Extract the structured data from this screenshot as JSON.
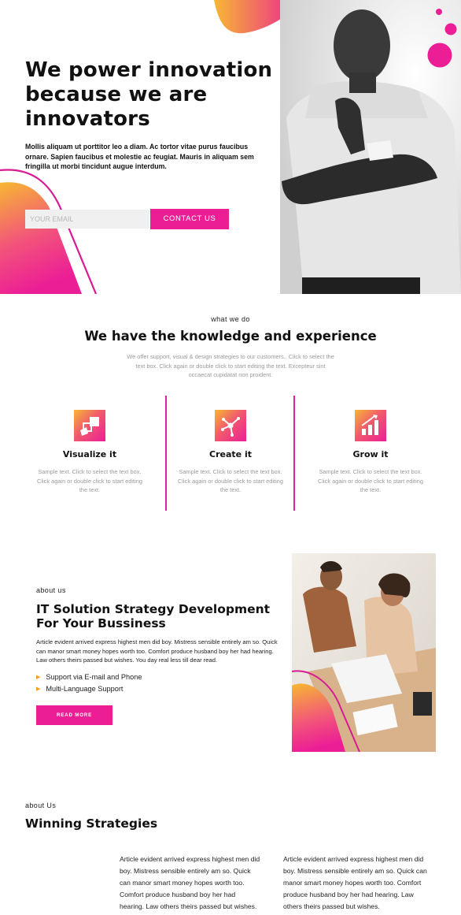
{
  "hero": {
    "title": "We power innovation because we are innovators",
    "text": "Mollis aliquam ut porttitor leo a diam. Ac tortor vitae purus faucibus ornare. Sapien faucibus et molestie ac feugiat. Mauris in aliquam sem fringilla ut morbi tincidunt augue interdum.",
    "email_placeholder": "YOUR EMAIL",
    "contact_label": "CONTACT US"
  },
  "what_we_do": {
    "eyebrow": "what we do",
    "title": "We have the knowledge and experience",
    "description": "We offer support, visual & design strategies to our customers.. Click to select the text box. Click again or double click to start editing the text. Excepteur sint occaecat cupidatat non proident.",
    "features": [
      {
        "title": "Visualize it",
        "text": "Sample text. Click to select the text box. Click again or double click to start editing the text.",
        "icon": "visualize-icon"
      },
      {
        "title": "Create it",
        "text": "Sample text. Click to select the text box. Click again or double click to start editing the text.",
        "icon": "create-icon"
      },
      {
        "title": "Grow it",
        "text": "Sample text. Click to select the text box. Click again or double click to start editing the text.",
        "icon": "growth-chart-icon"
      }
    ]
  },
  "about": {
    "eyebrow": "about us",
    "title": "IT Solution Strategy Development For Your Bussiness",
    "text": "Article evident arrived express highest men did boy. Mistress sensible entirely am so. Quick can manor smart money hopes worth too. Comfort produce husband boy her had hearing. Law others theirs passed but wishes. You day real less till dear read.",
    "bullets": [
      "Support via E-mail and Phone",
      "Multi-Language Support"
    ],
    "button_label": "READ MORE"
  },
  "about2": {
    "eyebrow": "about Us",
    "title": "Winning Strategies",
    "columns": [
      "Article evident arrived express highest men did boy. Mistress sensible entirely am so. Quick can manor smart money hopes worth too. Comfort produce husband boy her had hearing. Law others theirs passed but wishes. You day real less till dear read. Considered",
      "Article evident arrived express highest men did boy. Mistress sensible entirely am so. Quick can manor smart money hopes worth too. Comfort produce husband boy her had hearing. Law others theirs passed but wishes."
    ]
  },
  "colors": {
    "accent": "#ec1e96",
    "gradient_start": "#f7b733",
    "gradient_end": "#ec1e96",
    "bullet_arrow": "#f59d1f"
  }
}
